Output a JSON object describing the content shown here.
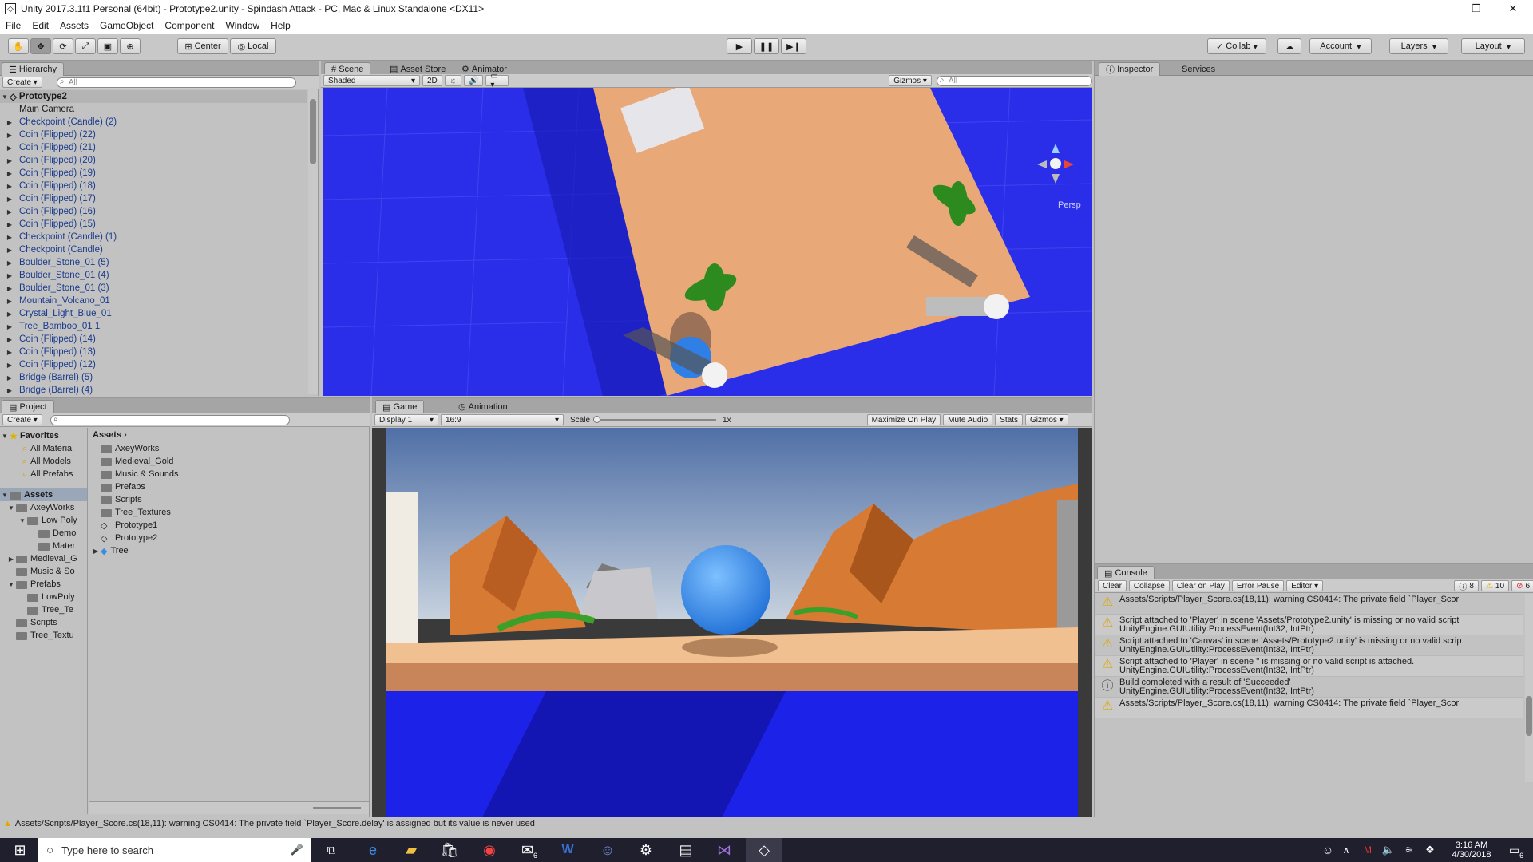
{
  "window": {
    "title": "Unity 2017.3.1f1 Personal (64bit) - Prototype2.unity - Spindash Attack - PC, Mac & Linux Standalone <DX11>"
  },
  "menu": [
    "File",
    "Edit",
    "Assets",
    "GameObject",
    "Component",
    "Window",
    "Help"
  ],
  "toolbar": {
    "center": "Center",
    "local": "Local",
    "collab": "Collab",
    "account": "Account",
    "layers": "Layers",
    "layout": "Layout"
  },
  "hierarchy": {
    "tab": "Hierarchy",
    "create": "Create",
    "search_placeholder": "All",
    "scene": "Prototype2",
    "items": [
      {
        "label": "Main Camera",
        "arrow": false,
        "cam": true
      },
      {
        "label": "Checkpoint (Candle) (2)",
        "arrow": true
      },
      {
        "label": "Coin (Flipped) (22)",
        "arrow": true
      },
      {
        "label": "Coin (Flipped) (21)",
        "arrow": true
      },
      {
        "label": "Coin (Flipped) (20)",
        "arrow": true
      },
      {
        "label": "Coin (Flipped) (19)",
        "arrow": true
      },
      {
        "label": "Coin (Flipped) (18)",
        "arrow": true
      },
      {
        "label": "Coin (Flipped) (17)",
        "arrow": true
      },
      {
        "label": "Coin (Flipped) (16)",
        "arrow": true
      },
      {
        "label": "Coin (Flipped) (15)",
        "arrow": true
      },
      {
        "label": "Checkpoint (Candle) (1)",
        "arrow": true
      },
      {
        "label": "Checkpoint (Candle)",
        "arrow": true
      },
      {
        "label": "Boulder_Stone_01 (5)",
        "arrow": true
      },
      {
        "label": "Boulder_Stone_01 (4)",
        "arrow": true
      },
      {
        "label": "Boulder_Stone_01 (3)",
        "arrow": true
      },
      {
        "label": "Mountain_Volcano_01",
        "arrow": true
      },
      {
        "label": "Crystal_Light_Blue_01",
        "arrow": true
      },
      {
        "label": "Tree_Bamboo_01 1",
        "arrow": true
      },
      {
        "label": "Coin (Flipped) (14)",
        "arrow": true
      },
      {
        "label": "Coin (Flipped) (13)",
        "arrow": true
      },
      {
        "label": "Coin (Flipped) (12)",
        "arrow": true
      },
      {
        "label": "Bridge (Barrel) (5)",
        "arrow": true
      },
      {
        "label": "Bridge (Barrel) (4)",
        "arrow": true
      }
    ]
  },
  "scene": {
    "tabs": [
      "Scene",
      "Asset Store",
      "Animator"
    ],
    "shaded": "Shaded",
    "mode2d": "2D",
    "gizmos": "Gizmos",
    "search_placeholder": "All",
    "persp": "Persp"
  },
  "inspector": {
    "tabs": [
      "Inspector",
      "Services"
    ]
  },
  "project": {
    "tab": "Project",
    "create": "Create",
    "favorites": "Favorites",
    "fav_items": [
      "All Materia",
      "All Models",
      "All Prefabs"
    ],
    "assets_label": "Assets",
    "tree": [
      {
        "label": "AxeyWorks",
        "indent": 1,
        "arrow": "open"
      },
      {
        "label": "Low Poly",
        "indent": 2,
        "arrow": "open"
      },
      {
        "label": "Demo",
        "indent": 3,
        "arrow": ""
      },
      {
        "label": "Mater",
        "indent": 3,
        "arrow": ""
      },
      {
        "label": "Medieval_G",
        "indent": 1,
        "arrow": "closed"
      },
      {
        "label": "Music & So",
        "indent": 1,
        "arrow": ""
      },
      {
        "label": "Prefabs",
        "indent": 1,
        "arrow": "open"
      },
      {
        "label": "LowPoly",
        "indent": 2,
        "arrow": ""
      },
      {
        "label": "Tree_Te",
        "indent": 2,
        "arrow": ""
      },
      {
        "label": "Scripts",
        "indent": 1,
        "arrow": ""
      },
      {
        "label": "Tree_Textu",
        "indent": 1,
        "arrow": ""
      }
    ],
    "breadcrumb": "Assets",
    "files": [
      {
        "label": "AxeyWorks",
        "type": "folder"
      },
      {
        "label": "Medieval_Gold",
        "type": "folder"
      },
      {
        "label": "Music & Sounds",
        "type": "folder"
      },
      {
        "label": "Prefabs",
        "type": "folder"
      },
      {
        "label": "Scripts",
        "type": "folder"
      },
      {
        "label": "Tree_Textures",
        "type": "folder"
      },
      {
        "label": "Prototype1",
        "type": "scene"
      },
      {
        "label": "Prototype2",
        "type": "scene"
      },
      {
        "label": "Tree",
        "type": "prefab"
      }
    ]
  },
  "game": {
    "tabs": [
      "Game",
      "Animation"
    ],
    "display": "Display 1",
    "aspect": "16:9",
    "scale_label": "Scale",
    "scale_value": "1x",
    "maximize": "Maximize On Play",
    "mute": "Mute Audio",
    "stats": "Stats",
    "gizmos": "Gizmos"
  },
  "console": {
    "tab": "Console",
    "buttons": [
      "Clear",
      "Collapse",
      "Clear on Play",
      "Error Pause",
      "Editor"
    ],
    "counts": {
      "info": "8",
      "warn": "10",
      "error": "6"
    },
    "entries": [
      {
        "icon": "warn",
        "l1": "Assets/Scripts/Player_Score.cs(18,11): warning CS0414: The private field `Player_Scor",
        "l2": ""
      },
      {
        "icon": "warn",
        "l1": "Script attached to 'Player' in scene 'Assets/Prototype2.unity' is missing or no valid script",
        "l2": "UnityEngine.GUIUtility:ProcessEvent(Int32, IntPtr)"
      },
      {
        "icon": "warn",
        "l1": "Script attached to 'Canvas' in scene 'Assets/Prototype2.unity' is missing or no valid scrip",
        "l2": "UnityEngine.GUIUtility:ProcessEvent(Int32, IntPtr)"
      },
      {
        "icon": "warn",
        "l1": "Script attached to 'Player' in scene '' is missing or no valid script is attached.",
        "l2": "UnityEngine.GUIUtility:ProcessEvent(Int32, IntPtr)"
      },
      {
        "icon": "info",
        "l1": "Build completed with a result of 'Succeeded'",
        "l2": "UnityEngine.GUIUtility:ProcessEvent(Int32, IntPtr)"
      },
      {
        "icon": "warn",
        "l1": "Assets/Scripts/Player_Score.cs(18,11): warning CS0414: The private field `Player_Scor",
        "l2": ""
      }
    ]
  },
  "statusbar": {
    "text": "Assets/Scripts/Player_Score.cs(18,11): warning CS0414: The private field `Player_Score.delay' is assigned but its value is never used"
  },
  "taskbar": {
    "search_placeholder": "Type here to search",
    "time": "3:16 AM",
    "date": "4/30/2018",
    "mail_badge": "6",
    "notif_badge": "6"
  }
}
